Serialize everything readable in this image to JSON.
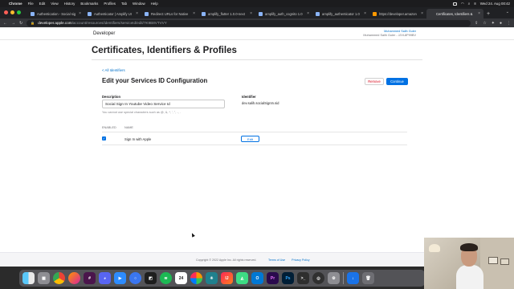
{
  "menubar": {
    "app": "Chrome",
    "items": [
      "File",
      "Edit",
      "View",
      "History",
      "Bookmarks",
      "Profiles",
      "Tab",
      "Window",
      "Help"
    ],
    "clock": "Wed 24. Aug 00:42"
  },
  "tabs": [
    {
      "title": "Authentication - Social sig",
      "active": false
    },
    {
      "title": "Authenticator | Amplify UI",
      "active": false
    },
    {
      "title": "Redirect URLs for Native",
      "active": false
    },
    {
      "title": "amplify_flutter 1.0.0-next",
      "active": false
    },
    {
      "title": "amplify_auth_cognito 1.0",
      "active": false
    },
    {
      "title": "amplify_authenticator 1.0",
      "active": false
    },
    {
      "title": "https://developer.amazon",
      "active": false
    },
    {
      "title": "Certificates, Identifiers &",
      "active": true
    }
  ],
  "address": {
    "domain": "developer.apple.com",
    "path": "/account/resources/identifiers/serviceId/edit/7K9B8VTVVY"
  },
  "header": {
    "logo_text": "Developer",
    "user_name": "Muhammed Salih Guler",
    "team": "Muhammed Salih Guler - JJVL8P99BV"
  },
  "page": {
    "title": "Certificates, Identifiers & Profiles",
    "back_link": "< All Identifiers",
    "section_title": "Edit your Services ID Configuration",
    "remove_label": "Remove",
    "continue_label": "Continue",
    "description_label": "Description",
    "description_value": "Social Sign In Youtube Video Service Id",
    "description_hint": "You cannot use special characters such as @, &, *, ', \", -, .",
    "identifier_label": "Identifier",
    "identifier_value": "dev.salih.socialSignIn.sid",
    "col_enabled": "ENABLED",
    "col_name": "NAME",
    "capability": {
      "name": "Sign In with Apple",
      "enabled": true,
      "edit_label": "Edit"
    }
  },
  "footer": {
    "copyright": "Copyright © 2022 Apple Inc. All rights reserved.",
    "links": [
      "Terms of Use",
      "Privacy Policy"
    ]
  },
  "colors": {
    "accent": "#0071e3",
    "link": "#0070c9",
    "remove": "#d70015"
  },
  "dock": {
    "calendar_day": "24",
    "apps": [
      "finder-icon",
      "launchpad-icon",
      "chrome-icon",
      "firefox-icon",
      "slack-icon",
      "discord-icon",
      "zoom-icon",
      "signal-icon",
      "vscode-icon",
      "spotify-icon",
      "calendar-icon",
      "photos-icon",
      "perplexity-icon",
      "intellij-icon",
      "android-studio-icon",
      "outlook-icon",
      "premiere-icon",
      "photoshop-icon",
      "terminal-icon",
      "obs-icon",
      "settings-icon",
      "trash-icon"
    ]
  }
}
